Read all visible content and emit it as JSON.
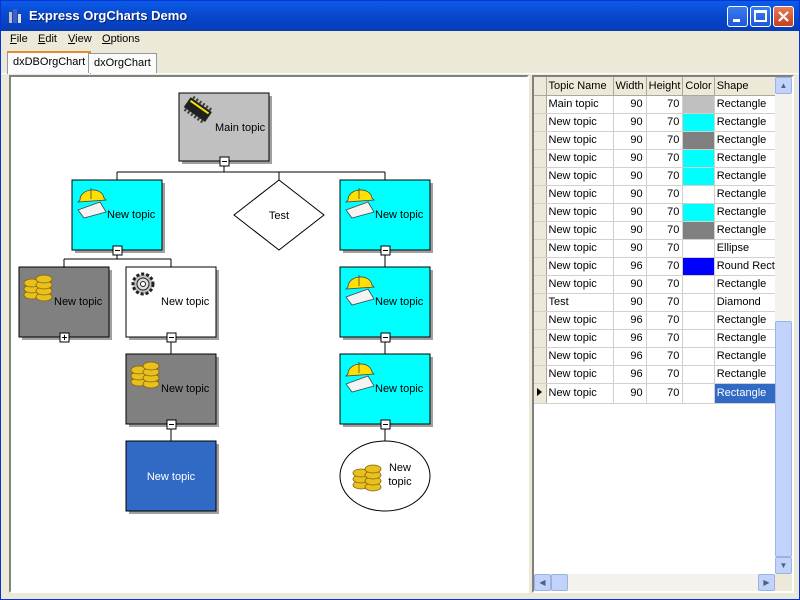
{
  "window": {
    "title": "Express OrgCharts Demo"
  },
  "menu": [
    {
      "pre": "",
      "u": "F",
      "post": "ile"
    },
    {
      "pre": "",
      "u": "E",
      "post": "dit"
    },
    {
      "pre": "",
      "u": "V",
      "post": "iew"
    },
    {
      "pre": "",
      "u": "O",
      "post": "ptions"
    }
  ],
  "tabs": [
    "dxDBOrgChart",
    "dxOrgChart"
  ],
  "chart": {
    "nodes": [
      {
        "id": "main",
        "text": "Main topic",
        "shape": "rect",
        "fill": "#c0c0c0",
        "icon": "chip-icon",
        "exp": "minus"
      },
      {
        "id": "n1",
        "text": "New topic",
        "shape": "rect",
        "fill": "#00ffff",
        "icon": "hardhat-icon",
        "exp": "minus"
      },
      {
        "id": "test",
        "text": "Test",
        "shape": "diamond",
        "fill": "#ffffff"
      },
      {
        "id": "n3",
        "text": "New topic",
        "shape": "rect",
        "fill": "#00ffff",
        "icon": "hardhat-icon",
        "exp": "minus"
      },
      {
        "id": "n4",
        "text": "New topic",
        "shape": "rect",
        "fill": "#808080",
        "icon": "coins-icon",
        "exp": "plus"
      },
      {
        "id": "n5",
        "text": "New topic",
        "shape": "rect",
        "fill": "#ffffff",
        "icon": "gear-icon",
        "exp": "minus"
      },
      {
        "id": "n6",
        "text": "New topic",
        "shape": "rect",
        "fill": "#808080",
        "icon": "coins-icon",
        "exp": "minus"
      },
      {
        "id": "n7",
        "text": "New topic",
        "shape": "rect",
        "fill": "#316ac5",
        "textColor": "#ffffff"
      },
      {
        "id": "n8",
        "text": "New topic",
        "shape": "rect",
        "fill": "#00ffff",
        "icon": "hardhat-icon",
        "exp": "minus"
      },
      {
        "id": "n9",
        "text": "New topic",
        "shape": "rect",
        "fill": "#00ffff",
        "icon": "hardhat-icon",
        "exp": "minus"
      },
      {
        "id": "n10",
        "text": "New topic",
        "shape": "ellipse",
        "fill": "#ffffff",
        "icon": "coins-icon"
      }
    ]
  },
  "grid": {
    "columns": [
      "Topic Name",
      "Width",
      "Height",
      "Color",
      "Shape"
    ],
    "rows": [
      [
        "Main topic",
        "90",
        "70",
        "#c0c0c0",
        "Rectangle"
      ],
      [
        "New topic",
        "90",
        "70",
        "#00ffff",
        "Rectangle"
      ],
      [
        "New topic",
        "90",
        "70",
        "#808080",
        "Rectangle"
      ],
      [
        "New topic",
        "90",
        "70",
        "#00ffff",
        "Rectangle"
      ],
      [
        "New topic",
        "90",
        "70",
        "#00ffff",
        "Rectangle"
      ],
      [
        "New topic",
        "90",
        "70",
        "#ffffff",
        "Rectangle"
      ],
      [
        "New topic",
        "90",
        "70",
        "#00ffff",
        "Rectangle"
      ],
      [
        "New topic",
        "90",
        "70",
        "#808080",
        "Rectangle"
      ],
      [
        "New topic",
        "90",
        "70",
        "#ffffff",
        "Ellipse"
      ],
      [
        "New topic",
        "96",
        "70",
        "#0000ff",
        "Round Rect"
      ],
      [
        "New topic",
        "90",
        "70",
        "#ffffff",
        "Rectangle"
      ],
      [
        "Test",
        "90",
        "70",
        "#ffffff",
        "Diamond"
      ],
      [
        "New topic",
        "96",
        "70",
        "#ffffff",
        "Rectangle"
      ],
      [
        "New topic",
        "96",
        "70",
        "#ffffff",
        "Rectangle"
      ],
      [
        "New topic",
        "96",
        "70",
        "#ffffff",
        "Rectangle"
      ],
      [
        "New topic",
        "96",
        "70",
        "#ffffff",
        "Rectangle"
      ],
      [
        "New topic",
        "90",
        "70",
        "#ffffff",
        "Rectangle"
      ]
    ],
    "selected_row": 16
  }
}
